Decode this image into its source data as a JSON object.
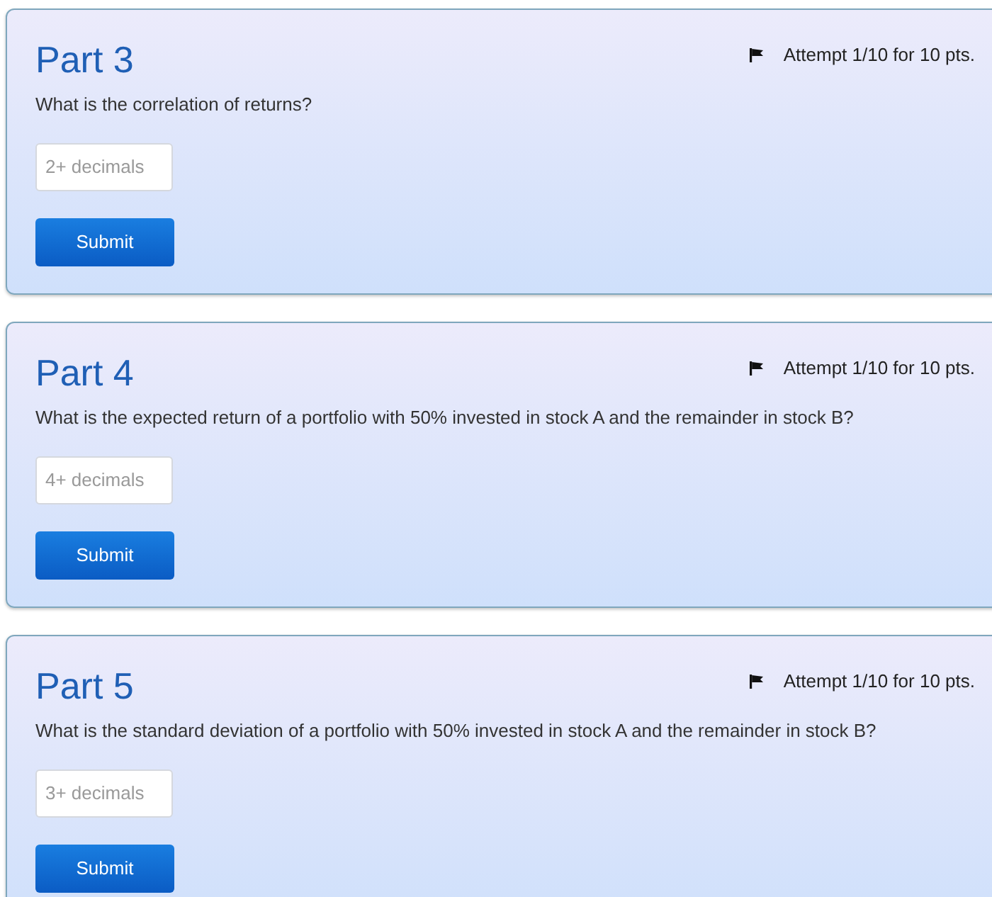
{
  "parts": [
    {
      "title": "Part 3",
      "attempt": "Attempt 1/10 for 10 pts.",
      "question": "What is the correlation of returns?",
      "placeholder": "2+ decimals",
      "button": "Submit"
    },
    {
      "title": "Part 4",
      "attempt": "Attempt 1/10 for 10 pts.",
      "question": "What is the expected return of a portfolio with 50% invested in stock A and the remainder in stock B?",
      "placeholder": "4+ decimals",
      "button": "Submit"
    },
    {
      "title": "Part 5",
      "attempt": "Attempt 1/10 for 10 pts.",
      "question": "What is the standard deviation of a portfolio with 50% invested in stock A and the remainder in stock B?",
      "placeholder": "3+ decimals",
      "button": "Submit"
    }
  ]
}
